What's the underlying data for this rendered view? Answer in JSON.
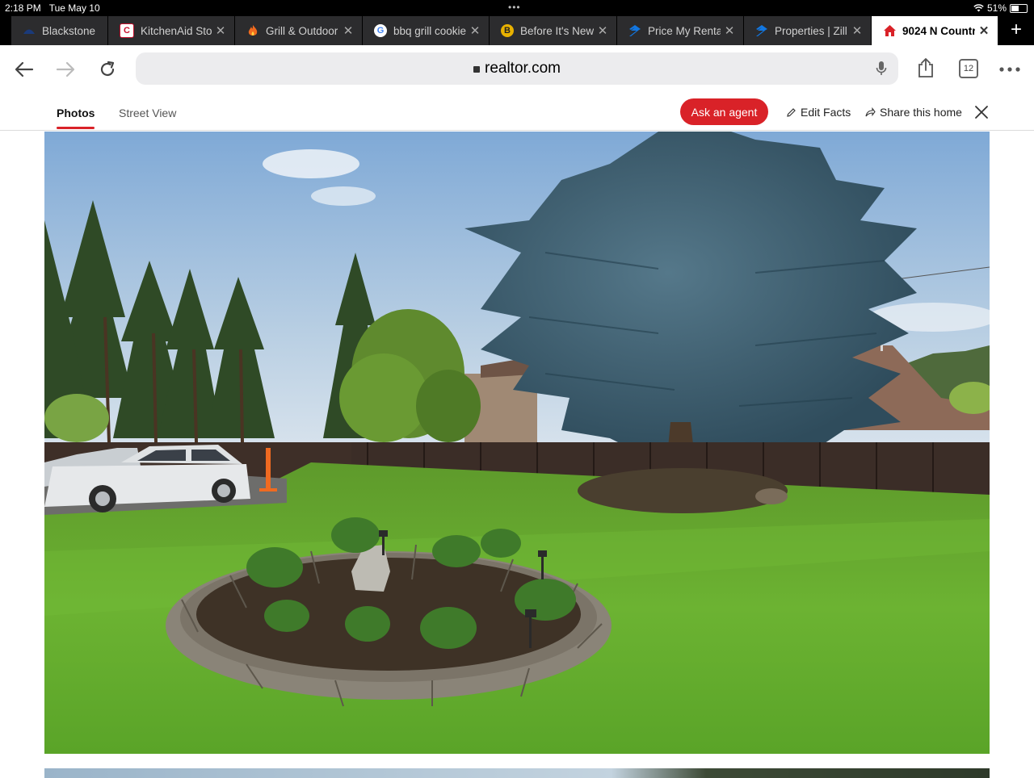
{
  "status_bar": {
    "time": "2:18 PM",
    "date": "Tue May 10",
    "battery": "51%",
    "battery_level": 0.51
  },
  "tabs": [
    {
      "label": "Blackstone",
      "icon": "blackstone-icon",
      "active": false
    },
    {
      "label": "KitchenAid Sto",
      "icon": "kitchenaid-icon",
      "active": false
    },
    {
      "label": "Grill & Outdoor",
      "icon": "flame-icon",
      "active": false
    },
    {
      "label": "bbq grill cookie",
      "icon": "google-icon",
      "active": false
    },
    {
      "label": "Before It's New",
      "icon": "before-its-new-icon",
      "active": false
    },
    {
      "label": "Price My Renta",
      "icon": "zillow-icon",
      "active": false
    },
    {
      "label": "Properties | Zill",
      "icon": "zillow-icon",
      "active": false
    },
    {
      "label": "9024 N Countr",
      "icon": "realtor-home-icon",
      "active": true
    }
  ],
  "toolbar": {
    "url": "realtor.com",
    "tab_count": "12"
  },
  "listing_header": {
    "tab_photos": "Photos",
    "tab_street_view": "Street View",
    "ask_agent": "Ask an agent",
    "edit_facts": "Edit Facts",
    "share": "Share this home"
  },
  "colors": {
    "brand_red": "#d92228",
    "tab_bg": "#2c2c2e"
  }
}
